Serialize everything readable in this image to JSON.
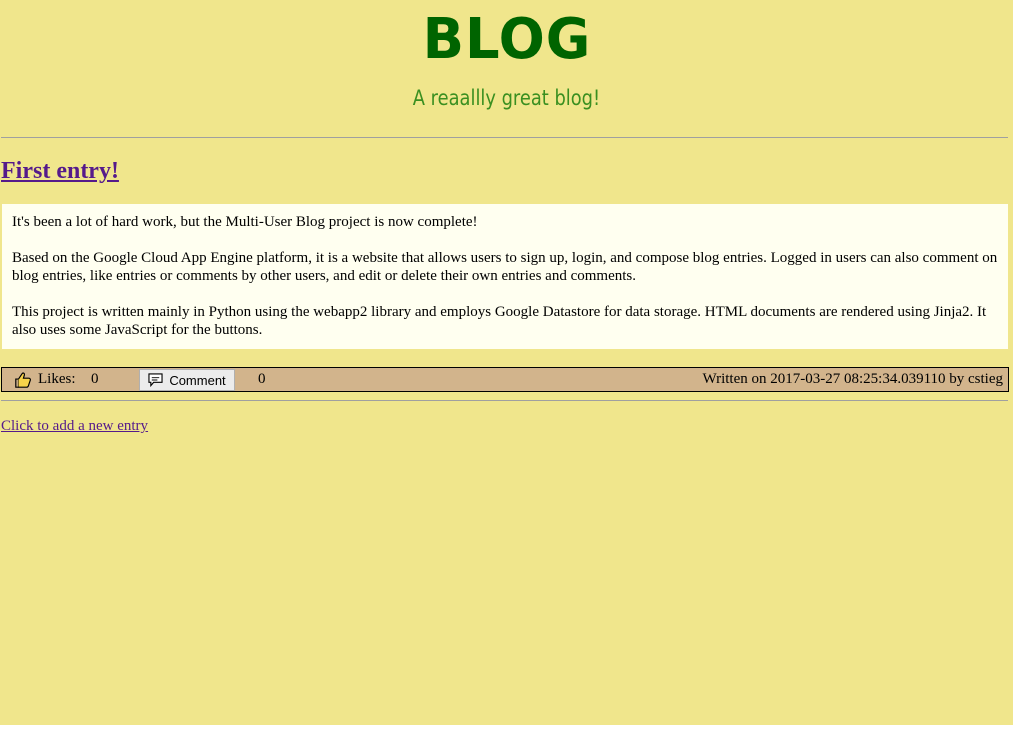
{
  "header": {
    "title": "BLOG",
    "subtitle": "A reaallly great blog!"
  },
  "entry": {
    "title": "First entry!",
    "paragraphs": [
      "It's been a lot of hard work, but the Multi-User Blog project is now complete!",
      "Based on the Google Cloud App Engine platform, it is a website that allows users to sign up, login, and compose blog entries. Logged in users can also comment on blog entries, like entries or comments by other users, and edit or delete their own entries and comments.",
      "This project is written mainly in Python using the webapp2 library and employs Google Datastore for data storage. HTML documents are rendered using Jinja2. It also uses some JavaScript for the buttons."
    ],
    "likes_label": "Likes:",
    "likes_count": "0",
    "comment_label": "Comment",
    "comment_count": "0",
    "written": "Written on 2017-03-27 08:25:34.039110 by cstieg"
  },
  "footer": {
    "add_entry_link": "Click to add a new entry"
  },
  "icons": {
    "like": "thumbs-up-icon",
    "comment": "speech-bubble-icon"
  },
  "colors": {
    "background": "#f0e68c",
    "title": "#006400",
    "entry_body": "#fffff0",
    "action_bar": "#d2b48c",
    "link": "#551a8b"
  }
}
